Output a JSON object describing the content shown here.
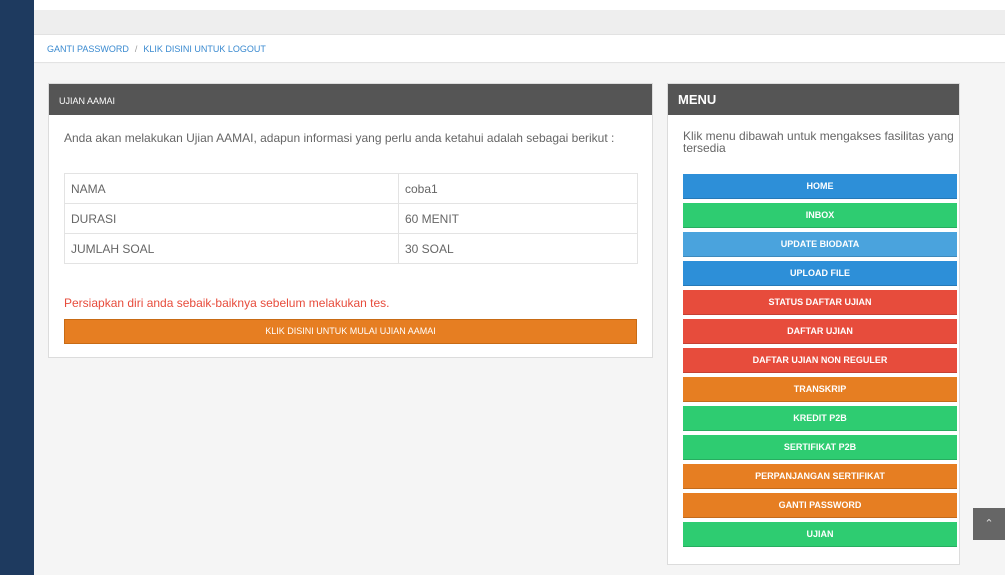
{
  "breadcrumb": {
    "change_password": "GANTI PASSWORD",
    "separator": "/",
    "logout": "KLIK DISINI UNTUK LOGOUT"
  },
  "exam_panel": {
    "title": "UJIAN AAMAI",
    "intro": "Anda akan melakukan Ujian AAMAI, adapun informasi yang perlu anda ketahui adalah sebagai berikut :",
    "rows": [
      {
        "label": "NAMA",
        "value": "coba1"
      },
      {
        "label": "DURASI",
        "value": "60 MENIT"
      },
      {
        "label": "JUMLAH SOAL",
        "value": "30 SOAL"
      }
    ],
    "warning": "Persiapkan diri anda sebaik-baiknya sebelum melakukan tes.",
    "start_button": "KLIK DISINI UNTUK MULAI UJIAN AAMAI"
  },
  "menu_panel": {
    "title": "MENU",
    "intro": "Klik menu dibawah untuk mengakses fasilitas yang tersedia",
    "items": [
      {
        "label": "HOME",
        "color": "#2d8fd8"
      },
      {
        "label": "INBOX",
        "color": "#2ecc71"
      },
      {
        "label": "UPDATE BIODATA",
        "color": "#4aa3dd"
      },
      {
        "label": "UPLOAD FILE",
        "color": "#2d8fd8"
      },
      {
        "label": "STATUS DAFTAR UJIAN",
        "color": "#e74c3c"
      },
      {
        "label": "DAFTAR UJIAN",
        "color": "#e74c3c"
      },
      {
        "label": "DAFTAR UJIAN NON REGULER",
        "color": "#e74c3c"
      },
      {
        "label": "TRANSKRIP",
        "color": "#e67e22"
      },
      {
        "label": "KREDIT P2B",
        "color": "#2ecc71"
      },
      {
        "label": "SERTIFIKAT P2B",
        "color": "#2ecc71"
      },
      {
        "label": "PERPANJANGAN SERTIFIKAT",
        "color": "#e67e22"
      },
      {
        "label": "GANTI PASSWORD",
        "color": "#e67e22"
      },
      {
        "label": "UJIAN",
        "color": "#2ecc71"
      }
    ]
  },
  "scroll_top_icon": "chevron-up-icon"
}
